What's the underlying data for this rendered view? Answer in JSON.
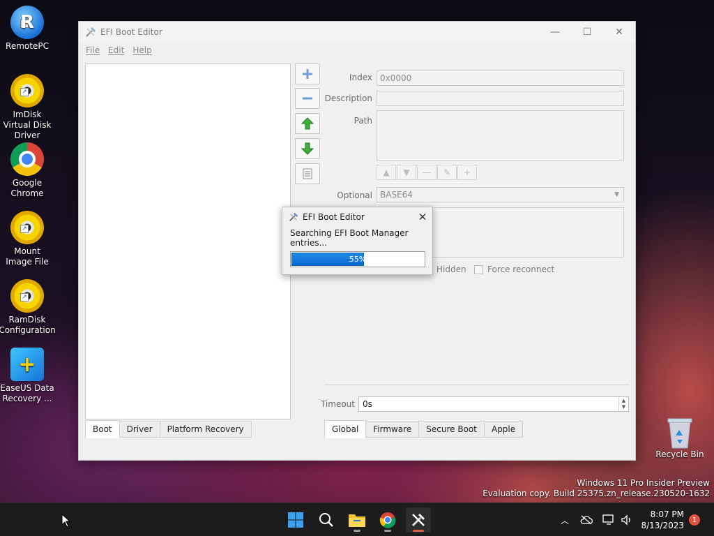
{
  "desktop": {
    "icons": [
      {
        "label": "RemotePC"
      },
      {
        "label": "ImDisk Virtual Disk Driver"
      },
      {
        "label": "Google Chrome"
      },
      {
        "label": "Mount Image File"
      },
      {
        "label": "RamDisk Configuration"
      },
      {
        "label": "EaseUS Data Recovery ..."
      }
    ],
    "recycle_bin": "Recycle Bin",
    "watermark": [
      "Windows 11 Pro Insider Preview",
      "Evaluation copy. Build 25375.zn_release.230520-1632"
    ]
  },
  "window": {
    "title": "EFI Boot Editor",
    "menu": [
      "File",
      "Edit",
      "Help"
    ],
    "left_tabs": [
      "Boot",
      "Driver",
      "Platform Recovery"
    ],
    "form": {
      "index_label": "Index",
      "index_value": "0x0000",
      "description_label": "Description",
      "description_value": "",
      "path_label": "Path",
      "optional_label": "Optional",
      "optional_value": "BASE64",
      "hidden_label": "Hidden",
      "force_reconnect_label": "Force reconnect"
    },
    "timeout_label": "Timeout",
    "timeout_value": "0s",
    "bottom_tabs": [
      "Global",
      "Firmware",
      "Secure Boot",
      "Apple"
    ]
  },
  "dialog": {
    "title": "EFI Boot Editor",
    "message": "Searching EFI Boot Manager entries...",
    "progress_percent": 55,
    "progress_text": "55%"
  },
  "taskbar": {
    "time": "8:07 PM",
    "date": "8/13/2023",
    "notification_count": "1"
  },
  "colors": {
    "accent": "#0a6ad1",
    "badge": "#e2533e"
  }
}
